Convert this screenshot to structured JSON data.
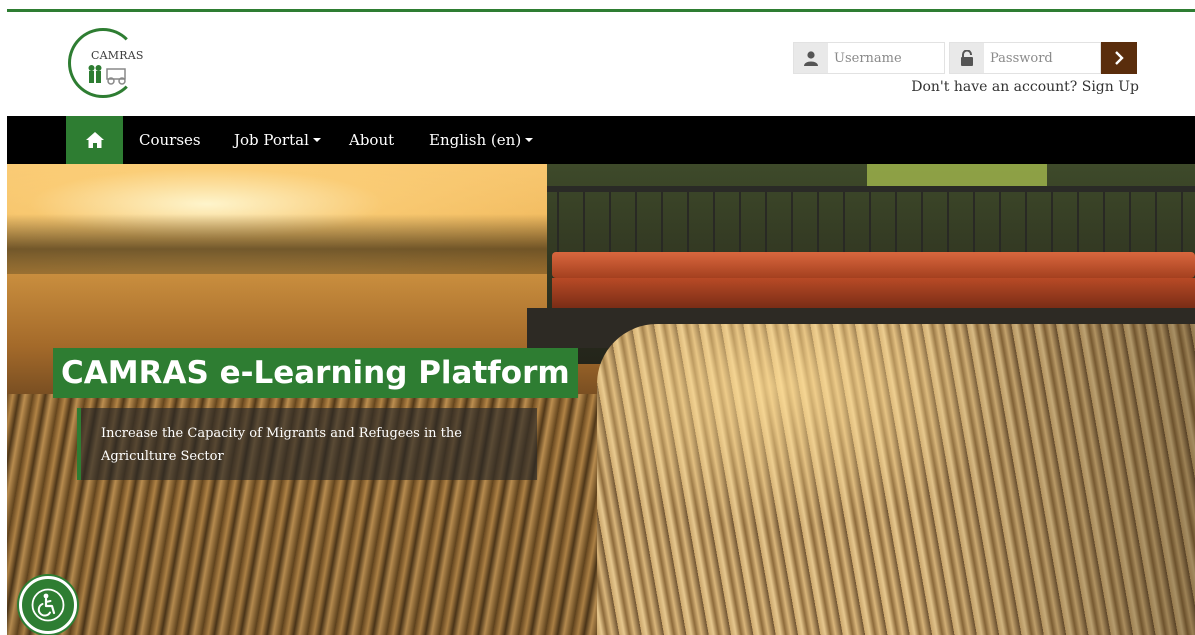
{
  "brand": {
    "logo_text": "CAMRAS",
    "accent_color": "#2e7d32",
    "login_button_color": "#5a2d0c"
  },
  "login": {
    "username_placeholder": "Username",
    "password_placeholder": "Password",
    "signup_text": "Don't have an account? Sign Up",
    "user_icon": "user-icon",
    "lock_icon": "lock-icon",
    "submit_icon": "chevron-right-icon"
  },
  "nav": {
    "home_icon": "home-icon",
    "items": [
      {
        "label": "Courses",
        "dropdown": false
      },
      {
        "label": "Job Portal",
        "dropdown": true
      },
      {
        "label": "About",
        "dropdown": false
      },
      {
        "label": "English (en)",
        "dropdown": true
      }
    ]
  },
  "hero": {
    "title": "CAMRAS e-Learning Platform",
    "subtitle": "Increase the Capacity of Migrants and Refugees in the Agriculture Sector"
  },
  "accessibility": {
    "icon": "accessibility-icon"
  }
}
